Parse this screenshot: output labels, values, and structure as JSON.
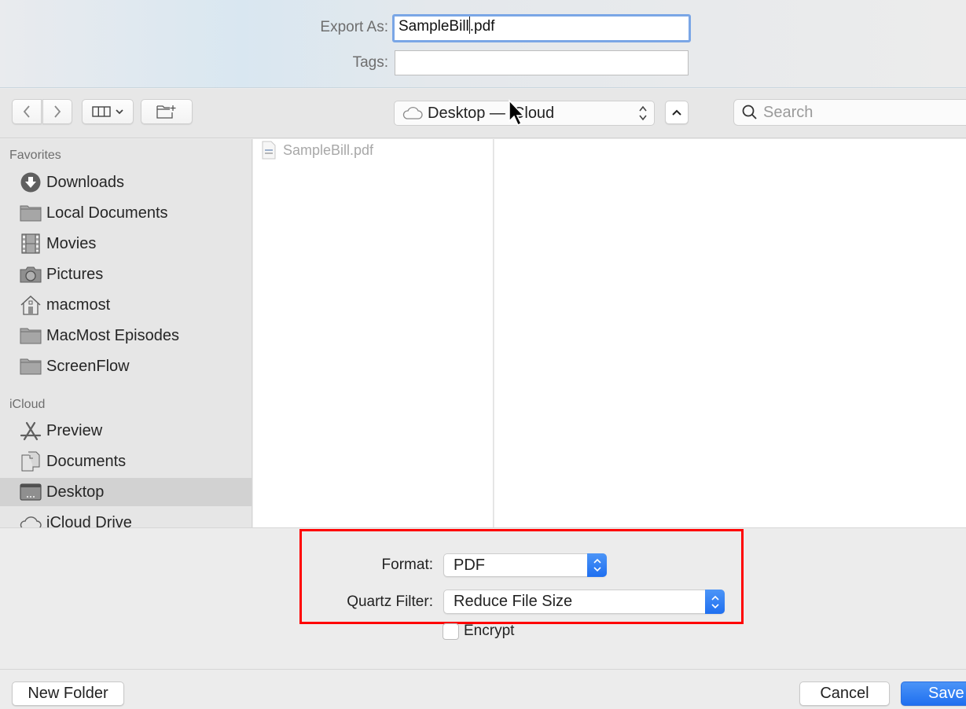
{
  "header": {
    "export_as_label": "Export As:",
    "filename_before_caret": "SampleBill",
    "filename_after_caret": ".pdf",
    "tags_label": "Tags:",
    "tags_value": ""
  },
  "toolbar": {
    "back_icon": "chevron-left-icon",
    "forward_icon": "chevron-right-icon",
    "view_icon": "column-view-icon",
    "new_folder_icon": "new-folder-icon",
    "location_icon": "cloud-icon",
    "location": "Desktop — iCloud",
    "expand_icon": "chevron-up-icon",
    "search_placeholder": "Search"
  },
  "sidebar": {
    "sections": [
      {
        "heading": "Favorites",
        "items": [
          {
            "label": "Downloads",
            "icon": "downloads-icon"
          },
          {
            "label": "Local Documents",
            "icon": "folder-icon"
          },
          {
            "label": "Movies",
            "icon": "film-icon"
          },
          {
            "label": "Pictures",
            "icon": "camera-icon"
          },
          {
            "label": "macmost",
            "icon": "home-icon"
          },
          {
            "label": "MacMost Episodes",
            "icon": "folder-icon"
          },
          {
            "label": "ScreenFlow",
            "icon": "folder-icon"
          }
        ]
      },
      {
        "heading": "iCloud",
        "items": [
          {
            "label": "Preview",
            "icon": "app-icon"
          },
          {
            "label": "Documents",
            "icon": "documents-icon"
          },
          {
            "label": "Desktop",
            "icon": "desktop-icon",
            "selected": true
          },
          {
            "label": "iCloud Drive",
            "icon": "cloud-icon"
          }
        ]
      }
    ]
  },
  "browser": {
    "files": [
      {
        "name": "SampleBill.pdf",
        "icon": "pdf-file-icon",
        "disabled": true
      }
    ]
  },
  "options": {
    "format_label": "Format:",
    "format_value": "PDF",
    "quartz_label": "Quartz Filter:",
    "quartz_value": "Reduce File Size",
    "encrypt_label": "Encrypt",
    "encrypt_checked": false,
    "highlight_color": "#ff0000"
  },
  "footer": {
    "new_folder": "New Folder",
    "cancel": "Cancel",
    "save": "Save"
  }
}
